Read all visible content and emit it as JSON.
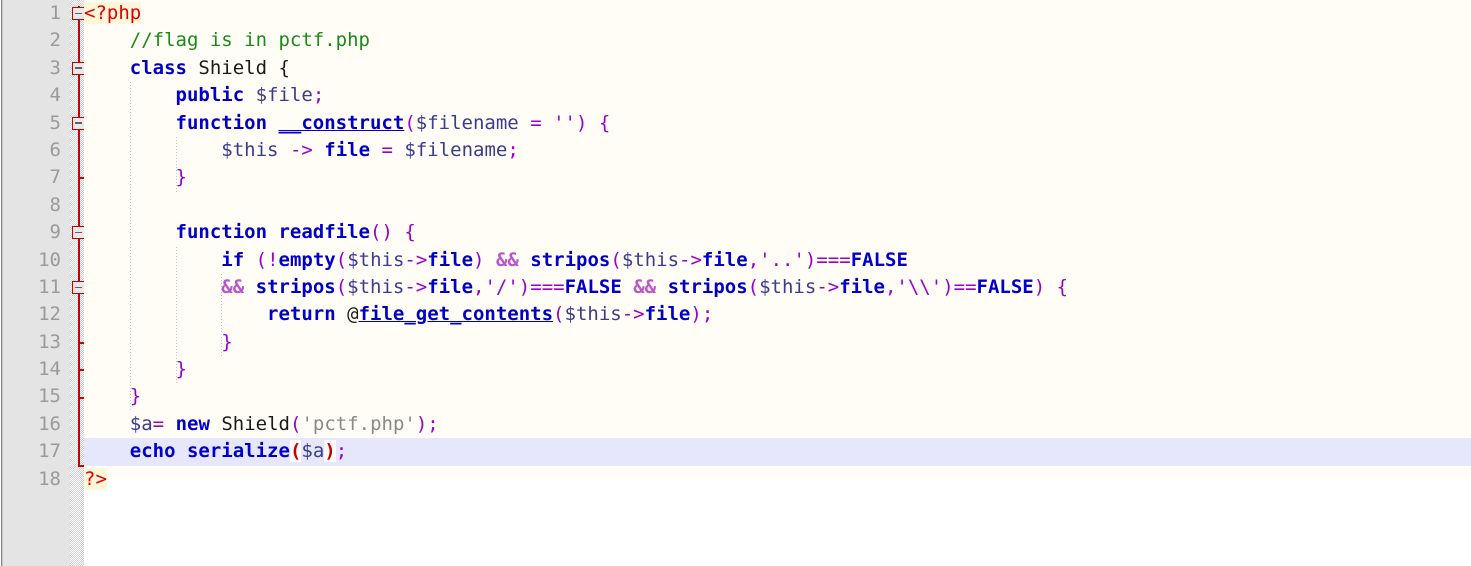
{
  "editor": {
    "language": "php",
    "filename_comment": "//flag is in pctf.php",
    "current_line": 17,
    "total_lines": 18,
    "colors": {
      "background": "#fffdf6",
      "gutter": "#e4e4e4",
      "line_number": "#9a9a9a",
      "current_line_highlight": "#e6e6fd",
      "fold_line": "#cc0000",
      "keyword": "#0000c8",
      "comment": "#1a8a1a",
      "string": "#8a8a8a",
      "operator": "#9900cc",
      "php_tag": "#dd0000",
      "matched_bracket": "#cc0000"
    }
  },
  "gutter": {
    "line_numbers": [
      "1",
      "2",
      "3",
      "4",
      "5",
      "6",
      "7",
      "8",
      "9",
      "10",
      "11",
      "12",
      "13",
      "14",
      "15",
      "16",
      "17",
      "18"
    ],
    "fold_boxes": [
      1,
      3,
      5,
      9,
      11
    ],
    "fold_ticks": [
      7,
      13,
      14,
      15
    ],
    "fold_line_start": 1,
    "fold_line_end": 18
  },
  "code": {
    "raw": [
      "<?php",
      "    //flag is in pctf.php",
      "    class Shield {",
      "        public $file;",
      "        function __construct($filename = '') {",
      "            $this -> file = $filename;",
      "        }",
      "",
      "        function readfile() {",
      "            if (!empty($this->file) && stripos($this->file,'..')===FALSE",
      "            && stripos($this->file,'/')===FALSE && stripos($this->file,'\\\\')==FALSE) {",
      "                return @file_get_contents($this->file);",
      "            }",
      "        }",
      "    }",
      "    $a= new Shield('pctf.php');",
      "    echo serialize($a);",
      "?>"
    ],
    "tokens": {
      "line1": {
        "php_open": "<?php"
      },
      "line2": {
        "comment": "//flag is in pctf.php"
      },
      "line3": {
        "keyword": "class",
        "name": "Shield",
        "brace": "{"
      },
      "line4": {
        "keyword": "public",
        "variable": "$file",
        "semicolon": ";"
      },
      "line5": {
        "keyword": "function",
        "name": "__construct",
        "paren_open": "(",
        "param": "$filename",
        "eq": "=",
        "default": "''",
        "paren_close": ")",
        "brace": "{"
      },
      "line6": {
        "this": "$this",
        "arrow": "->",
        "prop": "file",
        "eq": "=",
        "value": "$filename",
        "semicolon": ";"
      },
      "line7": {
        "brace": "}"
      },
      "line8": {
        "blank": ""
      },
      "line9": {
        "keyword": "function",
        "name": "readfile",
        "parens": "()",
        "brace": "{"
      },
      "line10": {
        "keyword": "if",
        "not": "!",
        "fn": "empty",
        "arg": "$this->file",
        "and": "&&",
        "fn2": "stripos",
        "args": "$this->file,'..'",
        "cmp": "===",
        "const": "FALSE"
      },
      "line11": {
        "and": "&&",
        "fn": "stripos",
        "args": "$this->file,'/'",
        "cmp": "===",
        "const": "FALSE",
        "and2": "&&",
        "fn2": "stripos",
        "args2": "$this->file,'\\\\'",
        "cmp2": "==",
        "const2": "FALSE",
        "brace": "{"
      },
      "line12": {
        "keyword": "return",
        "at": "@",
        "fn": "file_get_contents",
        "arg": "$this->file",
        "semicolon": ";"
      },
      "line13": {
        "brace": "}"
      },
      "line14": {
        "brace": "}"
      },
      "line15": {
        "brace": "}"
      },
      "line16": {
        "variable": "$a",
        "eq": "=",
        "keyword": "new",
        "class": "Shield",
        "arg": "'pctf.php'",
        "semicolon": ";"
      },
      "line17": {
        "keyword": "echo",
        "fn": "serialize",
        "paren_open": "(",
        "arg": "$a",
        "paren_close": ")",
        "semicolon": ";"
      },
      "line18": {
        "php_close": "?>"
      }
    }
  }
}
